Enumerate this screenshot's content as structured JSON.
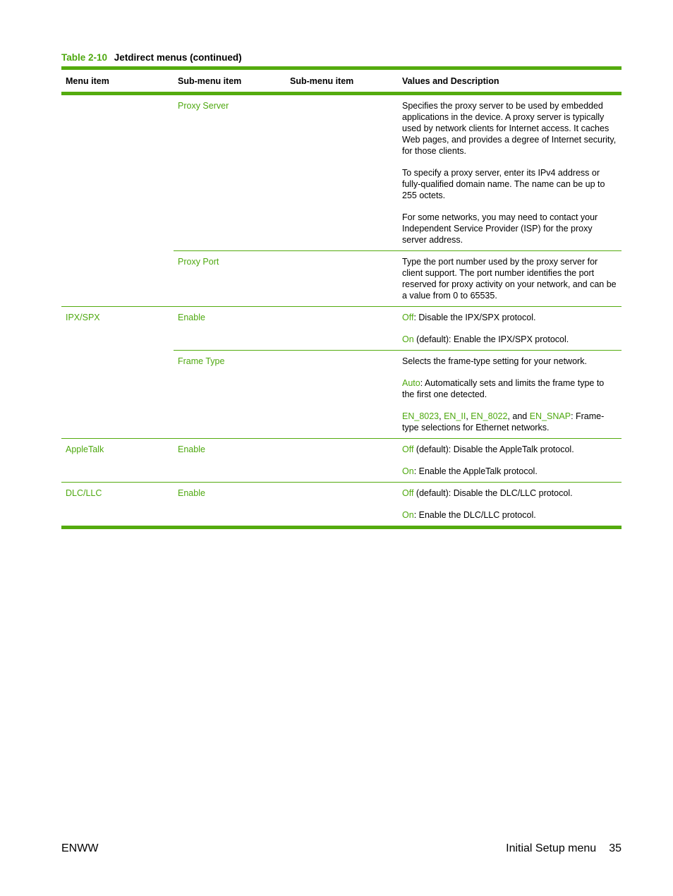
{
  "caption": {
    "number": "Table 2-10",
    "title": "Jetdirect menus (continued)"
  },
  "table": {
    "headers": [
      "Menu item",
      "Sub-menu item",
      "Sub-menu item",
      "Values and Description"
    ],
    "groups": [
      {
        "menu_item": "",
        "rows": [
          {
            "sub_item": "Proxy Server",
            "sub_item2": "",
            "paragraphs": [
              "Specifies the proxy server to be used by embedded applications in the device. A proxy server is typically used by network clients for Internet access. It caches Web pages, and provides a degree of Internet security, for those clients.",
              "To specify a proxy server, enter its IPv4 address or fully-qualified domain name. The name can be up to 255 octets.",
              "For some networks, you may need to contact your Independent Service Provider (ISP) for the proxy server address."
            ]
          },
          {
            "sub_item": "Proxy Port",
            "sub_item2": "",
            "paragraphs": [
              "Type the port number used by the proxy server for client support. The port number identifies the port reserved for proxy activity on your network, and can be a value from 0 to 65535."
            ]
          }
        ]
      },
      {
        "menu_item": "IPX/SPX",
        "rows": [
          {
            "sub_item": "Enable",
            "sub_item2": "",
            "options": [
              {
                "value": "Off",
                "text": ": Disable the IPX/SPX protocol."
              },
              {
                "value": "On",
                "text": " (default): Enable the IPX/SPX protocol."
              }
            ]
          },
          {
            "sub_item": "Frame Type",
            "sub_item2": "",
            "intro": "Selects the frame-type setting for your network.",
            "auto": {
              "value": "Auto",
              "text": ": Automatically sets and limits the frame type to the first one detected."
            },
            "frame_types": [
              "EN_8023",
              "EN_II",
              "EN_8022",
              "EN_SNAP"
            ],
            "frame_sep1": ", ",
            "frame_sep2": ", ",
            "frame_sep3": ", and ",
            "frame_tail": ": Frame-type selections for Ethernet networks."
          }
        ]
      },
      {
        "menu_item": "AppleTalk",
        "rows": [
          {
            "sub_item": "Enable",
            "sub_item2": "",
            "options": [
              {
                "value": "Off",
                "text": " (default): Disable the AppleTalk protocol."
              },
              {
                "value": "On",
                "text": ": Enable the AppleTalk protocol."
              }
            ]
          }
        ]
      },
      {
        "menu_item": "DLC/LLC",
        "rows": [
          {
            "sub_item": "Enable",
            "sub_item2": "",
            "options": [
              {
                "value": "Off",
                "text": " (default): Disable the DLC/LLC protocol."
              },
              {
                "value": "On",
                "text": ": Enable the DLC/LLC protocol."
              }
            ]
          }
        ]
      }
    ]
  },
  "footer": {
    "left": "ENWW",
    "section": "Initial Setup menu",
    "page": "35"
  },
  "colors": {
    "accent": "#4ea80f",
    "rule": "#54ab0e"
  }
}
